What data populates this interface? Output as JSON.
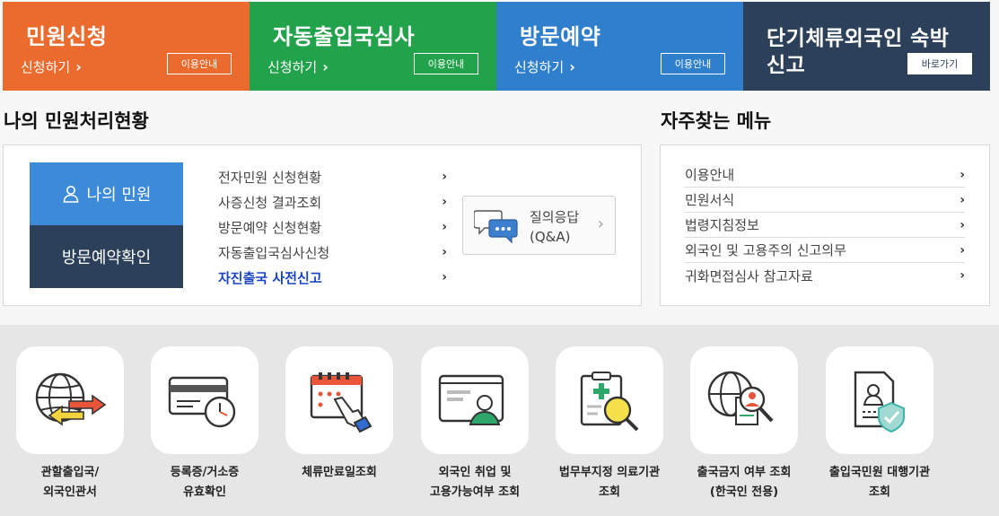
{
  "tiles": [
    {
      "title": "민원신청",
      "sub": "신청하기",
      "btn": "이용안내",
      "color": "#ea6b2d"
    },
    {
      "title": "자동출입국심사",
      "sub": "신청하기",
      "btn": "이용안내",
      "color": "#22a24a"
    },
    {
      "title": "방문예약",
      "sub": "신청하기",
      "btn": "이용안내",
      "color": "#2f7fcc"
    },
    {
      "title": "단기체류외국인 숙박\n신고",
      "sub": "",
      "btn": "바로가기",
      "color": "#2c4159"
    }
  ],
  "my_section": {
    "heading": "나의 민원처리현황",
    "my_civil_btn": "나의 민원",
    "visit_confirm_btn": "방문예약확인",
    "links": [
      "전자민원 신청현황",
      "사증신청 결과조회",
      "방문예약 신청현황",
      "자동출입국심사신청",
      "자진출국 사전신고"
    ],
    "qa_label": "질의응답\n(Q&A)"
  },
  "freq_section": {
    "heading": "자주찾는 메뉴",
    "links": [
      "이용안내",
      "민원서식",
      "법령지침정보",
      "외국인 및 고용주의 신고의무",
      "귀화면접심사 참고자료"
    ]
  },
  "shortcuts": [
    {
      "label": "관할출입국/\n외국인관서",
      "icon": "globe-arrows-icon"
    },
    {
      "label": "등록증/거소증\n유효확인",
      "icon": "id-card-clock-icon"
    },
    {
      "label": "체류만료일조회",
      "icon": "calendar-hand-icon"
    },
    {
      "label": "외국인 취업 및\n고용가능여부 조회",
      "icon": "worker-screen-icon"
    },
    {
      "label": "법무부지정 의료기관\n조회",
      "icon": "medical-search-icon"
    },
    {
      "label": "출국금지 여부 조회\n(한국인 전용)",
      "icon": "globe-search-icon"
    },
    {
      "label": "출입국민원 대행기관\n조회",
      "icon": "document-shield-icon"
    }
  ]
}
